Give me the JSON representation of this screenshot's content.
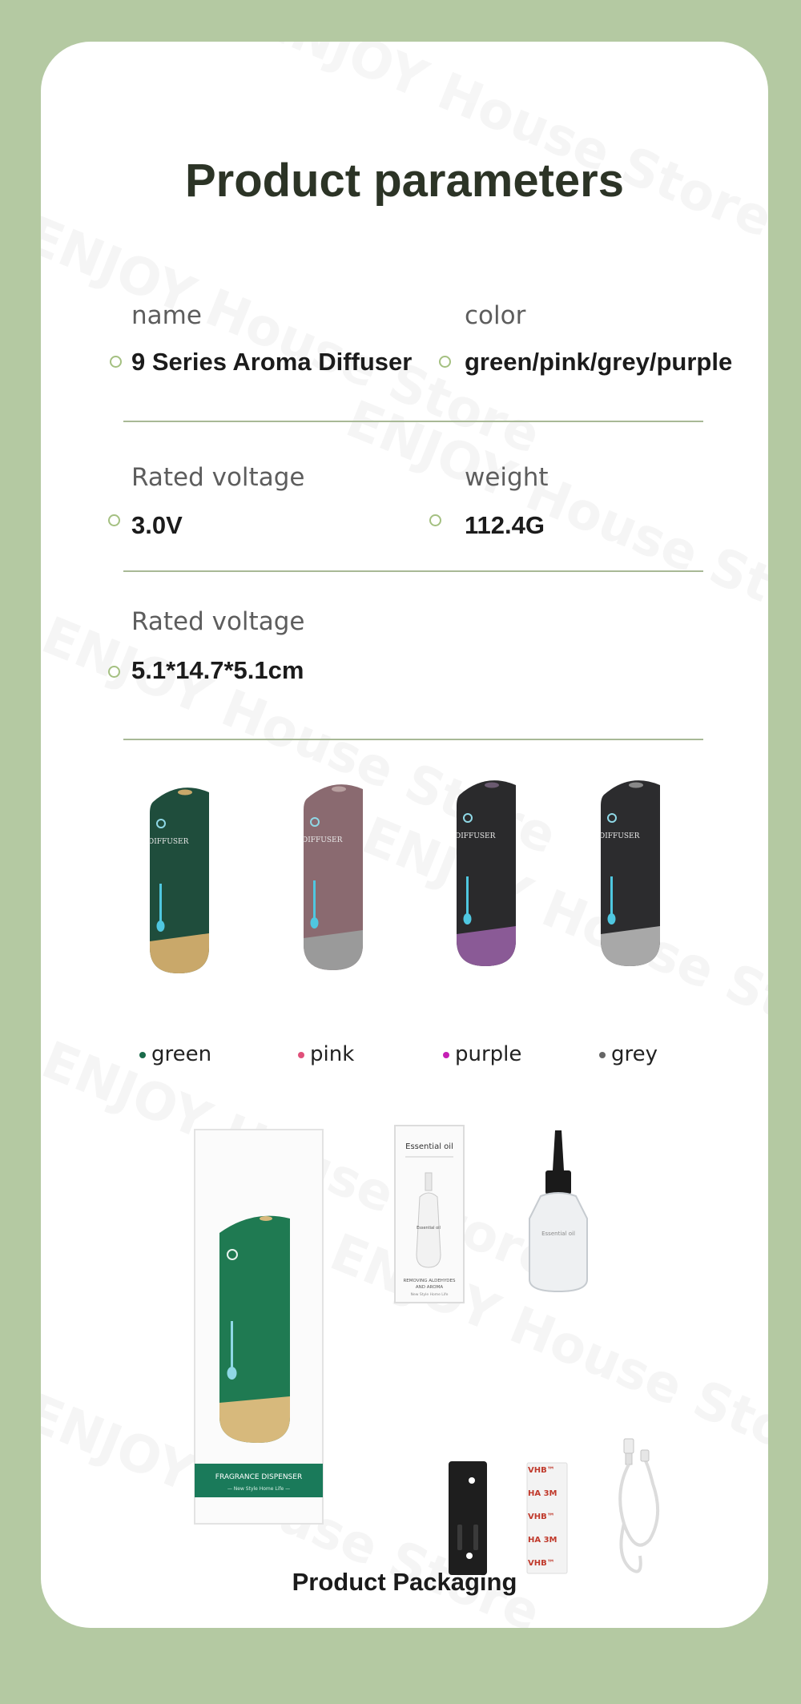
{
  "watermark": "ENJOY House Store",
  "title": "Product parameters",
  "params": {
    "name_label": "name",
    "name_value": "9 Series Aroma Diffuser",
    "color_label": "color",
    "color_value": "green/pink/grey/purple",
    "voltage_label": "Rated voltage",
    "voltage_value": "3.0V",
    "weight_label": "weight",
    "weight_value": "112.4G",
    "size_label": "Rated voltage",
    "size_value": "5.1*14.7*5.1cm"
  },
  "variants": [
    {
      "label": "green",
      "dot_color": "#1a6b4a",
      "body": "#1f4d3c",
      "base": "#c9a86a",
      "top_color": "#c9a86a"
    },
    {
      "label": "pink",
      "dot_color": "#e0507a",
      "body": "#8a6a70",
      "base": "#9a9a9a",
      "top_color": "#b8a0a0"
    },
    {
      "label": "purple",
      "dot_color": "#c51fb4",
      "body": "#2a2a2c",
      "base": "#8a5a96",
      "top_color": "#6a5a70"
    },
    {
      "label": "grey",
      "dot_color": "#666666",
      "body": "#2c2c2e",
      "base": "#a8a8a8",
      "top_color": "#888888"
    }
  ],
  "diffuser_label": "DIFFUSER",
  "box": {
    "band_title": "FRAGRANCE DISPENSER",
    "band_sub": "— New Style Home Life —"
  },
  "oil_box": {
    "title": "Essential oil",
    "bottle_label": "Essential oil",
    "line1": "REMOVING ALDEHYDES",
    "line2": "AND AROMA",
    "line3": "New Style Home Life"
  },
  "bottle_label": "Essential oil",
  "tape_text": [
    "VHB™",
    "HA 3M",
    "VHB™",
    "HA 3M",
    "VHB™"
  ],
  "packaging_title": "Product Packaging"
}
